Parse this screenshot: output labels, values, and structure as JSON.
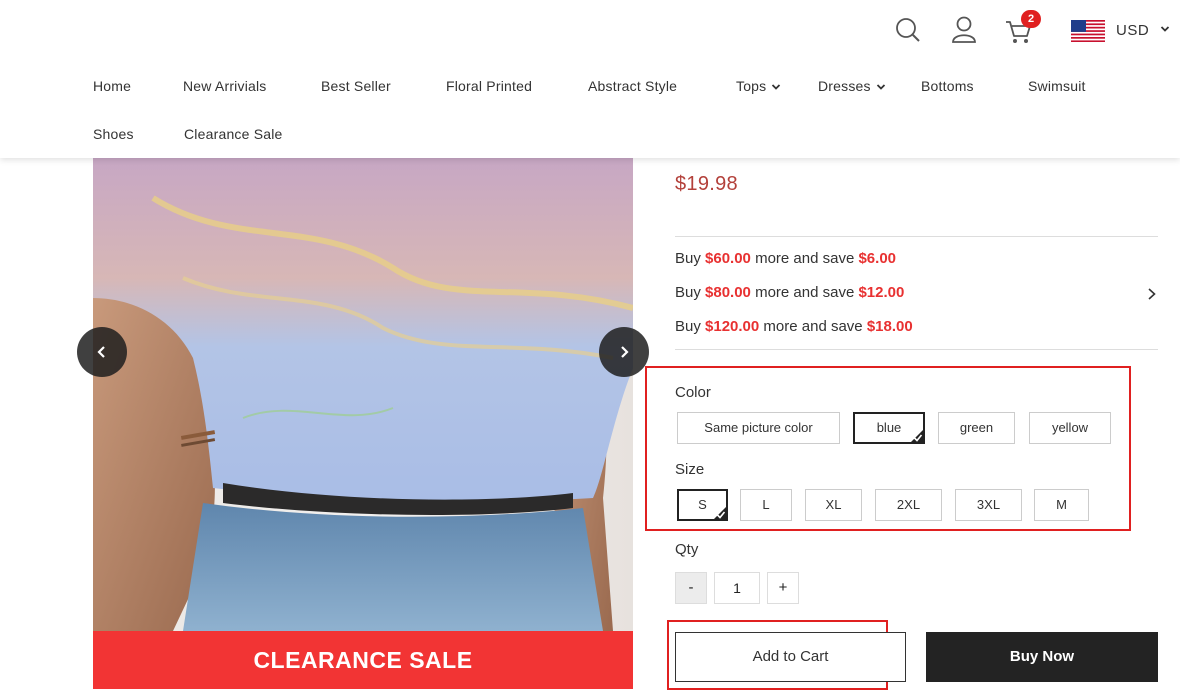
{
  "header": {
    "cart_count": "2",
    "currency": "USD"
  },
  "nav": {
    "items": [
      {
        "label": "Home"
      },
      {
        "label": "New Arrivials"
      },
      {
        "label": "Best Seller"
      },
      {
        "label": "Floral Printed"
      },
      {
        "label": "Abstract Style"
      },
      {
        "label": "Tops",
        "has_dropdown": true
      },
      {
        "label": "Dresses",
        "has_dropdown": true
      },
      {
        "label": "Bottoms"
      },
      {
        "label": "Swimsuit"
      },
      {
        "label": "Shoes"
      },
      {
        "label": "Clearance Sale"
      }
    ]
  },
  "gallery": {
    "banner": "CLEARANCE SALE",
    "banner_color": "#f23434"
  },
  "product": {
    "price": "$19.98",
    "promos": [
      {
        "prefix": "Buy ",
        "amount": "$60.00",
        "middle": " more and save ",
        "save": "$6.00"
      },
      {
        "prefix": "Buy ",
        "amount": "$80.00",
        "middle": " more and save ",
        "save": "$12.00"
      },
      {
        "prefix": "Buy ",
        "amount": "$120.00",
        "middle": " more and save ",
        "save": "$18.00"
      }
    ],
    "color": {
      "label": "Color",
      "options": [
        "Same picture color",
        "blue",
        "green",
        "yellow"
      ],
      "selected": "blue"
    },
    "size": {
      "label": "Size",
      "options": [
        "S",
        "L",
        "XL",
        "2XL",
        "3XL",
        "M"
      ],
      "selected": "S"
    },
    "qty": {
      "label": "Qty",
      "minus": "-",
      "value": "1",
      "plus": "+"
    },
    "add_to_cart": "Add to Cart",
    "buy_now": "Buy Now"
  },
  "colors": {
    "accent_red": "#e83131",
    "price": "#b3403a",
    "highlight_box": "#e02020",
    "buy_now_bg": "#232323"
  },
  "icons": [
    "search-icon",
    "user-icon",
    "cart-icon",
    "us-flag-icon",
    "chevron-down-icon",
    "chevron-left-icon",
    "chevron-right-icon",
    "check-icon"
  ]
}
